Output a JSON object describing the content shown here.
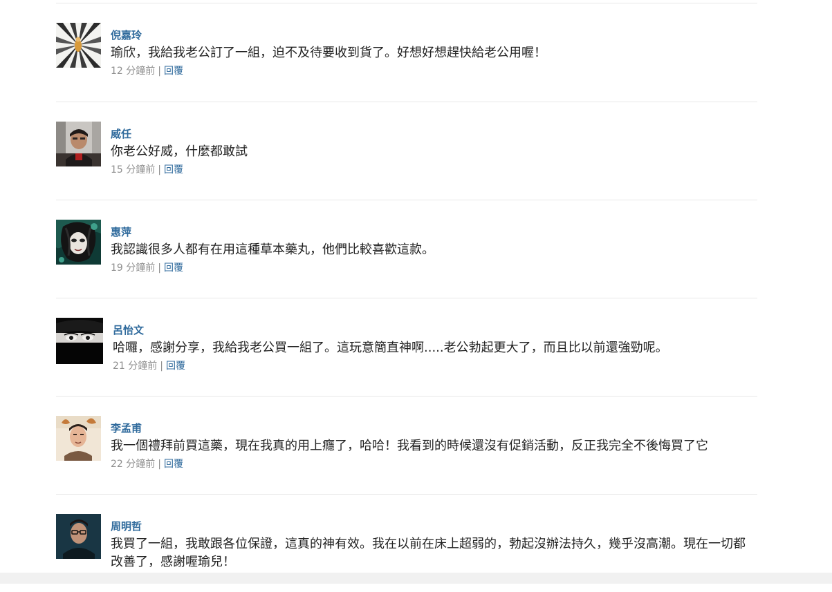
{
  "comments": [
    {
      "author": "倪嘉玲",
      "text": "瑜欣，我給我老公訂了一組，迫不及待要收到貨了。好想好想趕快給老公用喔！",
      "time": "12 分鐘前",
      "reply": "回覆",
      "sep": "|"
    },
    {
      "author": "威任",
      "text": "你老公好威，什麼都敢試",
      "time": "15 分鐘前",
      "reply": "回覆",
      "sep": "|"
    },
    {
      "author": "惠萍",
      "text": "我認識很多人都有在用這種草本藥丸，他們比較喜歡這款。",
      "time": "19 分鐘前",
      "reply": "回覆",
      "sep": "|"
    },
    {
      "author": "呂怡文",
      "text": "哈囉，感謝分享，我給我老公買一組了。這玩意簡直神啊.....老公勃起更大了，而且比以前還強勁呢。",
      "time": "21 分鐘前",
      "reply": "回覆",
      "sep": "|"
    },
    {
      "author": "李孟甫",
      "text": "我一個禮拜前買這藥，現在我真的用上癮了，哈哈！我看到的時候還沒有促銷活動，反正我完全不後悔買了它",
      "time": "22 分鐘前",
      "reply": "回覆",
      "sep": "|"
    },
    {
      "author": "周明哲",
      "text": "我買了一組，我敢跟各位保證，這真的神有效。我在以前在床上超弱的，勃起沒辦法持久，幾乎沒高潮。現在一切都改善了，感謝喔瑜兒！",
      "time": "",
      "reply": "",
      "sep": ""
    }
  ],
  "colors": {
    "author": "#2f6a9c",
    "text": "#222222",
    "meta": "#8f8f8f",
    "divider": "#e8e8e8"
  }
}
